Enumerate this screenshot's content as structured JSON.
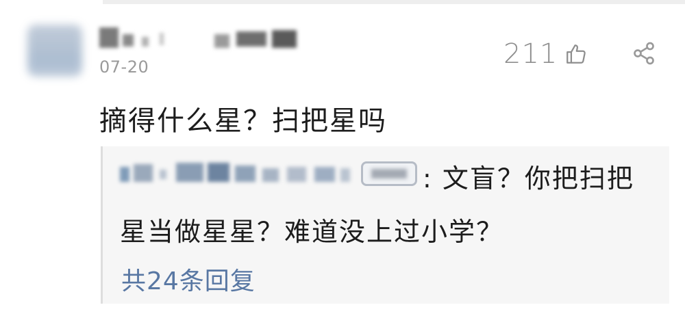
{
  "comment": {
    "date": "07-20",
    "like_count": "211",
    "text": "摘得什么星？扫把星吗"
  },
  "reply": {
    "text_line1": ": 文盲？你把扫把",
    "text_line2": "星当做星星？难道没上过小学？",
    "more_replies": "共24条回复"
  },
  "icons": {
    "like": "thumbs-up-icon",
    "share": "share-icon"
  },
  "colors": {
    "link": "#5877a3",
    "muted": "#8e8e8e",
    "text": "#1c1c1c",
    "reply_bg": "#f6f6f6"
  }
}
